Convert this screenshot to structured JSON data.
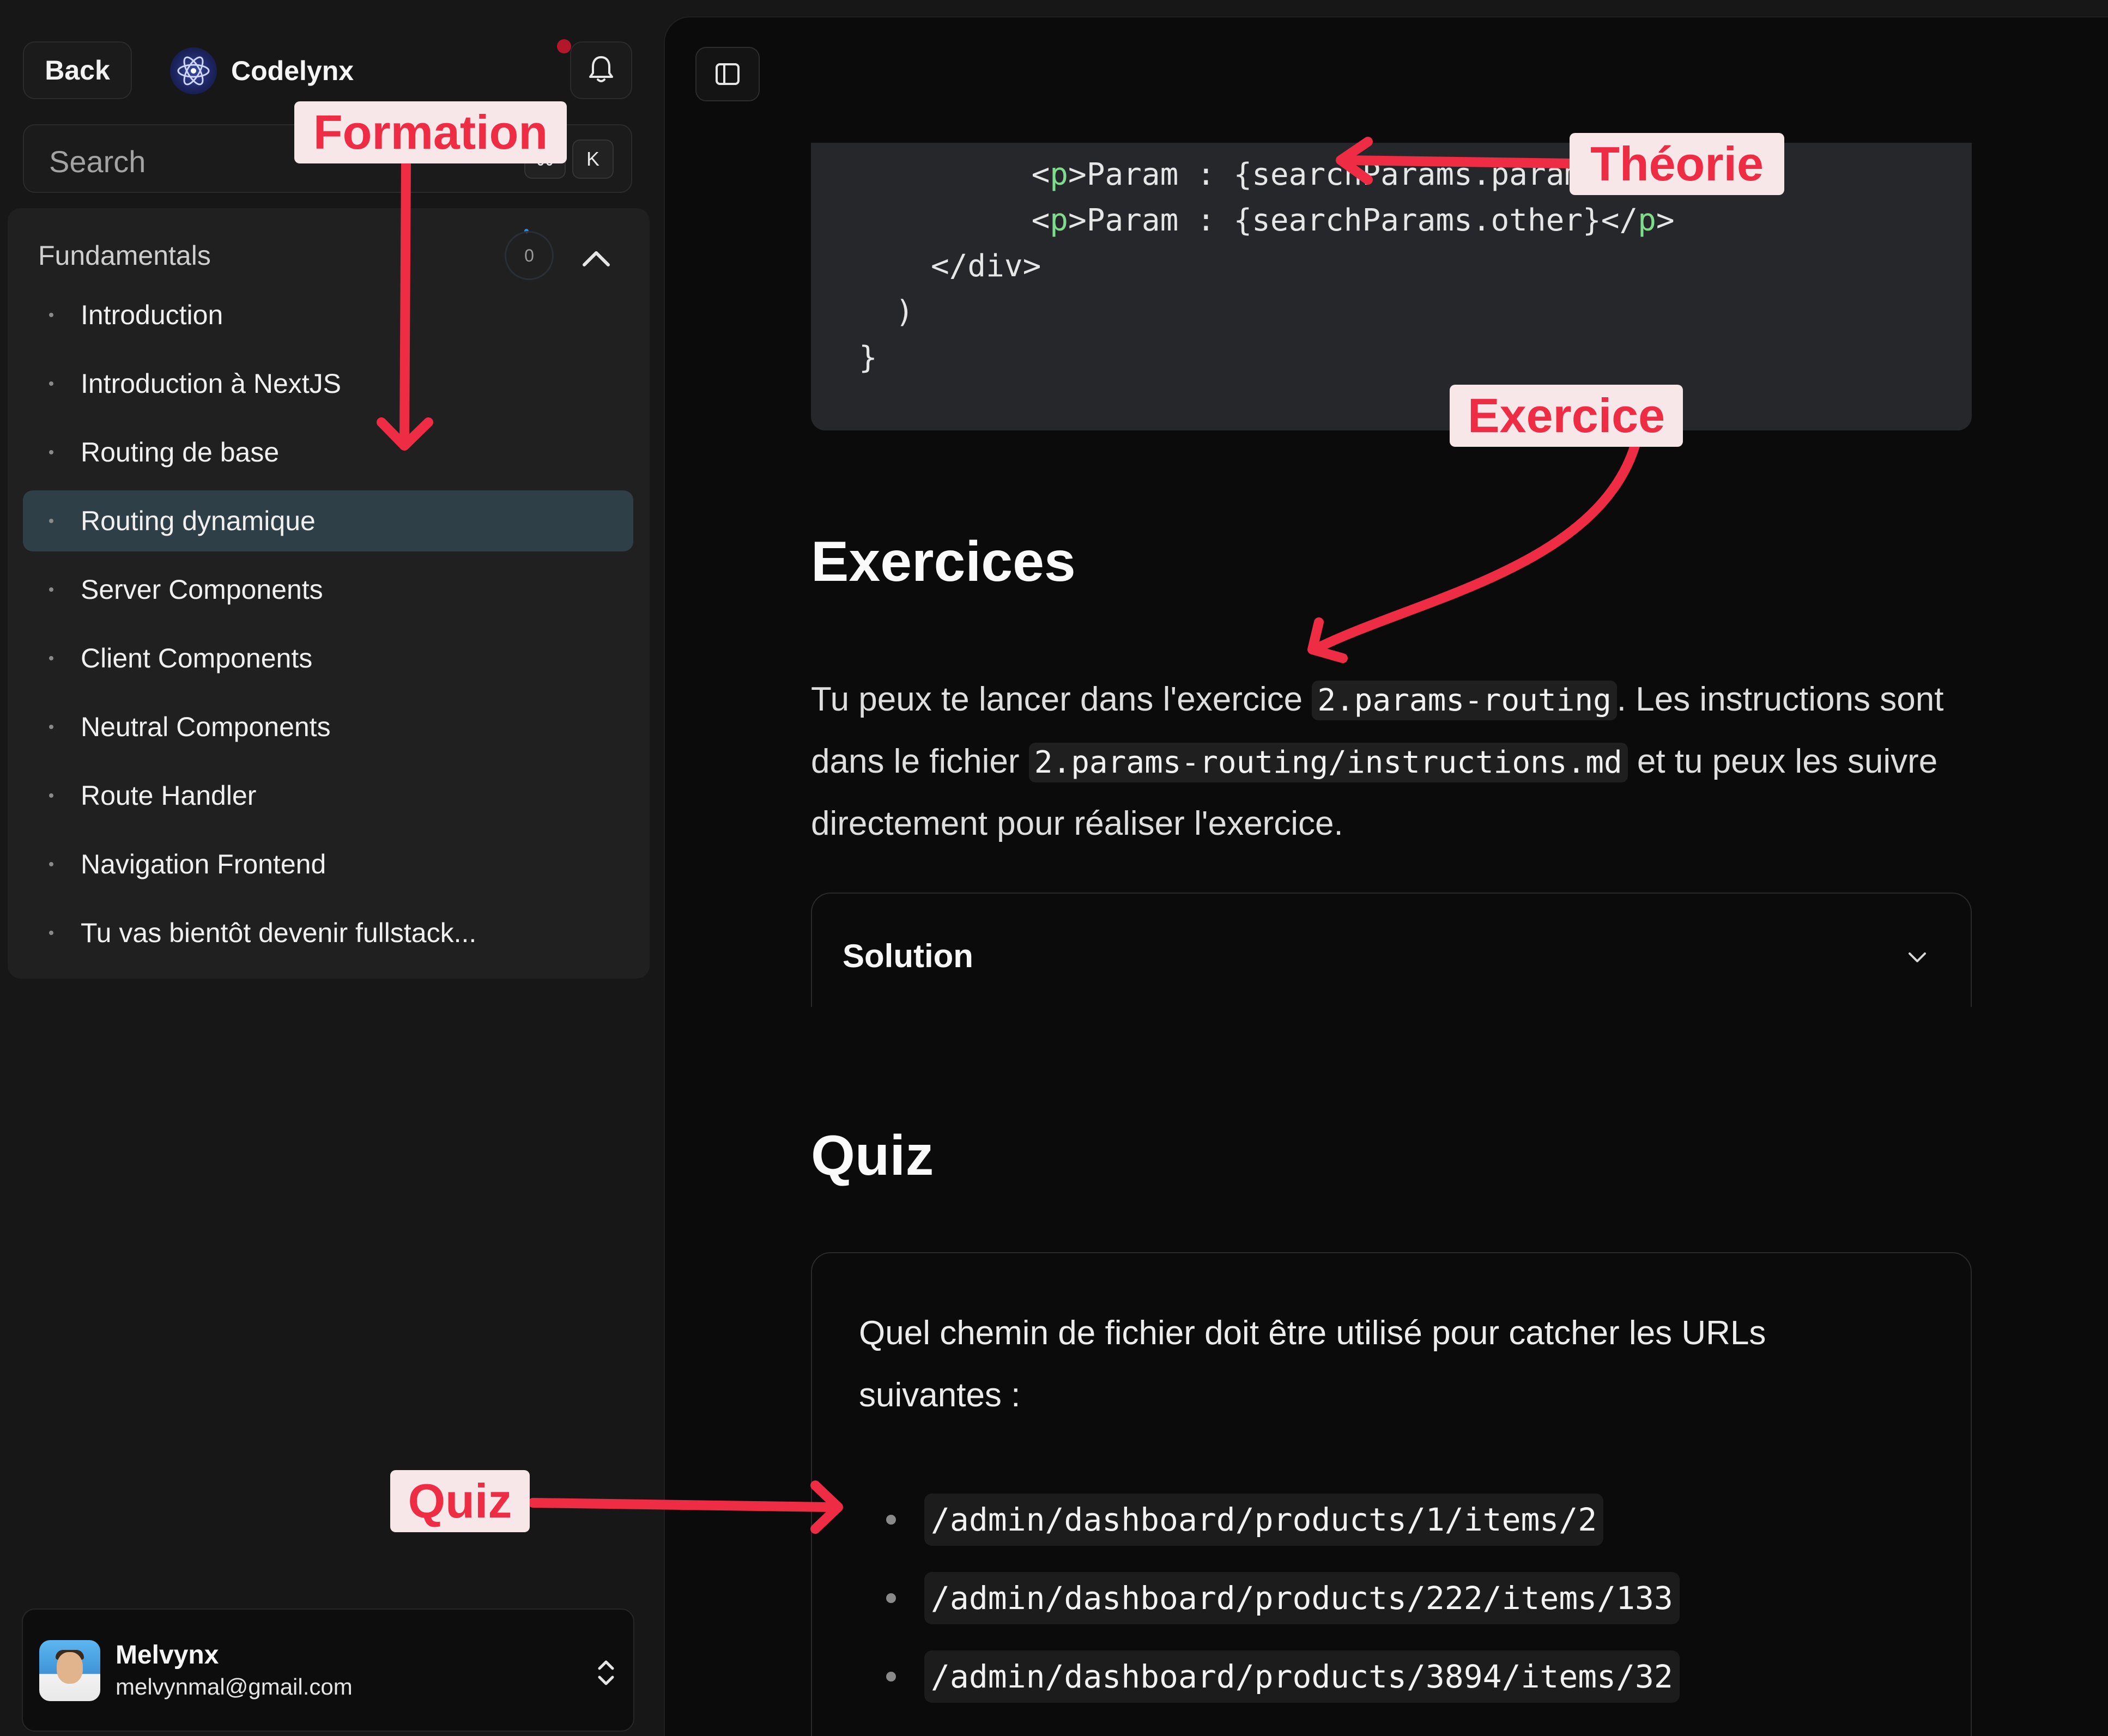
{
  "sidebar": {
    "back_label": "Back",
    "brand_name": "Codelynx",
    "search_placeholder": "Search",
    "shortcut_modifier": "⌘",
    "shortcut_key": "K",
    "module": {
      "title": "Fundamentals",
      "progress": "0",
      "lessons": [
        {
          "label": "Introduction",
          "active": false
        },
        {
          "label": "Introduction à NextJS",
          "active": false
        },
        {
          "label": "Routing de base",
          "active": false
        },
        {
          "label": "Routing dynamique",
          "active": true
        },
        {
          "label": "Server Components",
          "active": false
        },
        {
          "label": "Client Components",
          "active": false
        },
        {
          "label": "Neutral Components",
          "active": false
        },
        {
          "label": "Route Handler",
          "active": false
        },
        {
          "label": "Navigation Frontend",
          "active": false
        },
        {
          "label": "Tu vas bientôt devenir fullstack...",
          "active": false
        }
      ]
    },
    "user": {
      "name": "Melvynx",
      "email": "melvynmal@gmail.com"
    }
  },
  "main": {
    "code_lines": [
      {
        "indent": "    ",
        "open_tag": "p",
        "text": "Param : {searchParams.param}",
        "close": "</",
        "close_tag": "p"
      },
      {
        "indent": "    ",
        "open_tag": "p",
        "text": "Param : {searchParams.other}",
        "close": "</",
        "close_tag": "p"
      },
      {
        "indent": "  ",
        "raw": "</div>"
      },
      {
        "indent": " ",
        "raw": ")"
      },
      {
        "indent": "",
        "raw": "}"
      }
    ],
    "exercices": {
      "heading": "Exercices",
      "text_before": "Tu peux te lancer dans l'exercice",
      "exercise_code": "2.params-routing",
      "text_middle": ". Les instructions sont dans le fichier",
      "file_code": "2.params-routing/instructions.md",
      "text_after": "et tu peux les suivre directement pour réaliser l'exercice."
    },
    "solution_label": "Solution",
    "quiz": {
      "heading": "Quiz",
      "question": "Quel chemin de fichier doit être utilisé pour catcher les URLs suivantes :",
      "options": [
        "/admin/dashboard/products/1/items/2",
        "/admin/dashboard/products/222/items/133",
        "/admin/dashboard/products/3894/items/32"
      ]
    }
  },
  "annotations": {
    "formation": "Formation",
    "theorie": "Théorie",
    "exercice": "Exercice",
    "quiz": "Quiz",
    "color": "#ee2c44"
  }
}
